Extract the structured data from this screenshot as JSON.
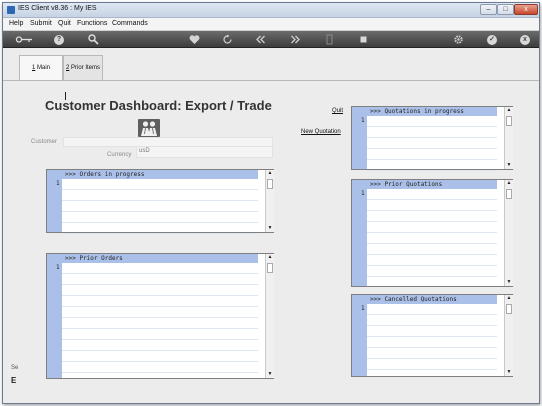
{
  "window": {
    "title": "IES Client v8.36 : My IES",
    "controls": {
      "minimize": "–",
      "maximize": "□",
      "close": "x"
    }
  },
  "menu": [
    "Help",
    "Submit",
    "Quit",
    "Functions",
    "Commands"
  ],
  "toolbar": {
    "icons": [
      "key-icon",
      "help-icon",
      "search-icon",
      "heart-icon",
      "refresh-icon",
      "rewind-icon",
      "fast-forward-icon",
      "document-icon",
      "stop-icon",
      "gear-icon",
      "check-icon",
      "close-icon"
    ],
    "glyphs": {
      "help": "?",
      "check": "✓",
      "close": "x"
    }
  },
  "tabs": [
    {
      "key": "1",
      "label": "Main"
    },
    {
      "key": "2",
      "label": "Prior Items"
    }
  ],
  "page_title": "Customer Dashboard: Export / Trade",
  "form": {
    "customer_label": "Customer",
    "customer_value": "",
    "currency_label": "Currency",
    "currency_value": "usD"
  },
  "links": {
    "quit": "Quit",
    "new_quotation": "New Quotation"
  },
  "grids": {
    "orders_in_progress": {
      "header": ">>> Orders in progress",
      "row": "1"
    },
    "prior_orders": {
      "header": ">>> Prior Orders",
      "row": "1"
    },
    "quotations_in_progress": {
      "header": ">>> Quotations in progress",
      "row": "1"
    },
    "prior_quotations": {
      "header": ">>> Prior Quotations",
      "row": "1"
    },
    "cancelled_quotations": {
      "header": ">>> Cancelled Quotations",
      "row": "1"
    }
  },
  "partial_text": {
    "left_edge_1": "Se",
    "left_edge_2": "E"
  },
  "colors": {
    "grid_header": "#aac0e8",
    "toolbar": "#3c3c3c",
    "close_button": "#c8462b"
  }
}
